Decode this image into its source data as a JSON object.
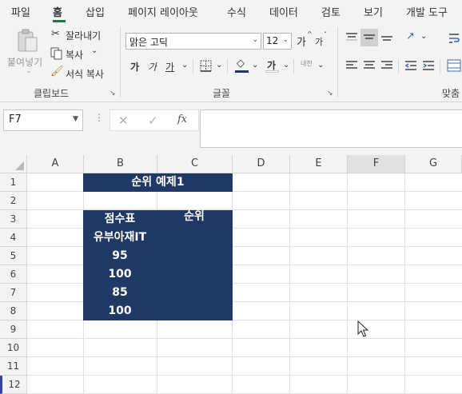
{
  "ribbon_tabs": [
    "파일",
    "홈",
    "삽입",
    "페이지 레이아웃",
    "수식",
    "데이터",
    "검토",
    "보기",
    "개발 도구"
  ],
  "active_tab": "홈",
  "clipboard": {
    "paste_label": "붙여넣기",
    "cut_label": "잘라내기",
    "copy_label": "복사",
    "format_painter_label": "서식 복사",
    "group_label": "클립보드"
  },
  "font": {
    "font_name": "맑은 고딕",
    "font_size": "12",
    "grow_glyph": "가",
    "shrink_glyph": "가",
    "bold_glyph": "가",
    "italic_glyph": "가",
    "underline_glyph": "가",
    "font_color_glyph": "가",
    "phonetic_glyph": "내천",
    "group_label": "글꼴"
  },
  "alignment": {
    "group_label": "맞춤"
  },
  "formula_bar": {
    "name_box": "F7",
    "fx_label": "fx",
    "formula": ""
  },
  "columns": [
    "A",
    "B",
    "C",
    "D",
    "E",
    "F",
    "G"
  ],
  "selected_column": "F",
  "rows": [
    "1",
    "2",
    "3",
    "4",
    "5",
    "6",
    "7",
    "8",
    "9",
    "10",
    "11",
    "12"
  ],
  "active_row": "12",
  "cells": {
    "title": "순위 예제1",
    "header_score": "점수표",
    "header_rank": "순위",
    "name": "유부아재IT",
    "values": [
      "95",
      "100",
      "85",
      "100"
    ]
  },
  "colors": {
    "table_fill": "#1f3864",
    "table_text": "#ffffff",
    "accent": "#217346"
  }
}
